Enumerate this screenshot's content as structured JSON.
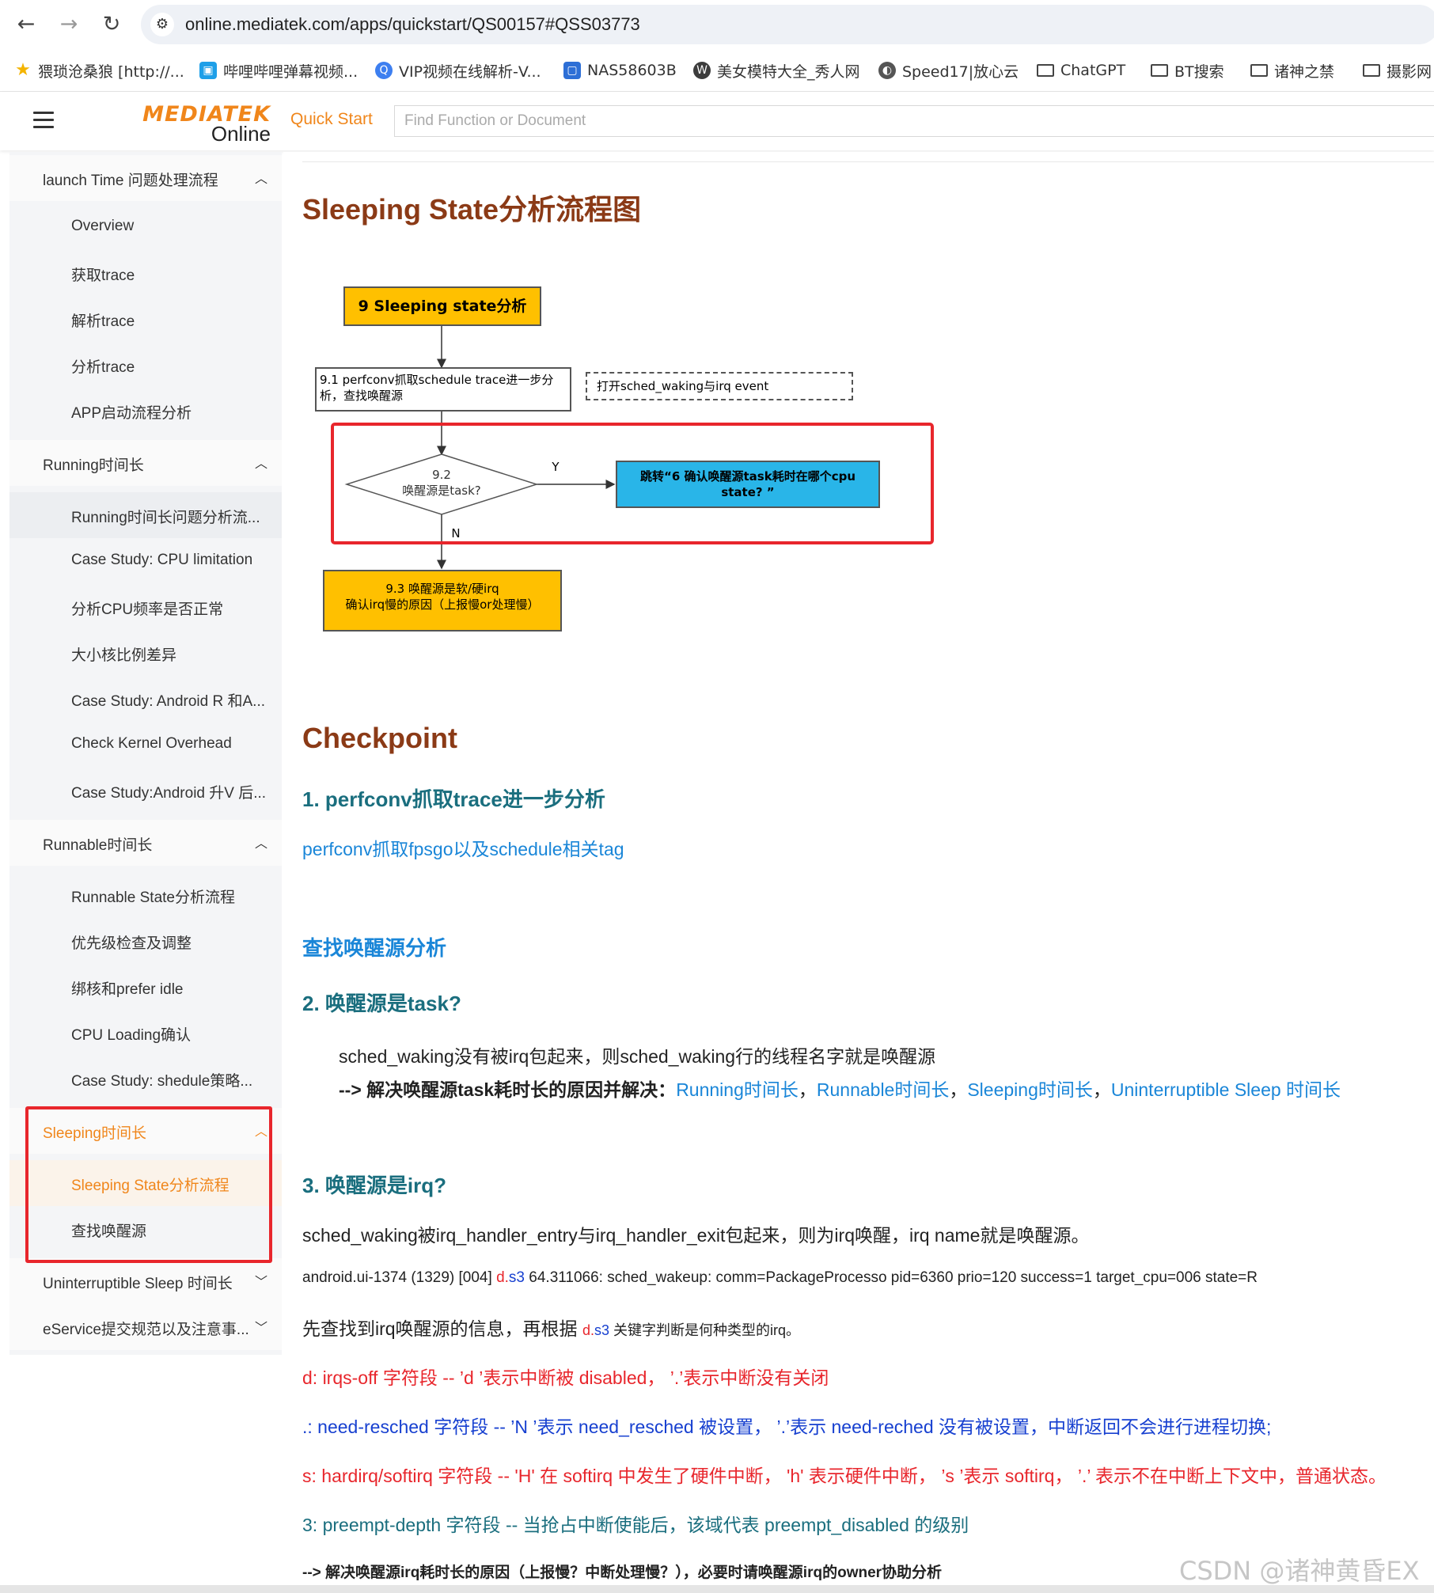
{
  "browser": {
    "back_icon": "arrow-left-icon",
    "forward_icon": "arrow-right-icon",
    "reload_icon": "reload-icon",
    "url": "online.mediatek.com/apps/quickstart/QS00157#QSS03773",
    "bookmarks": [
      {
        "label": "猥琐沧桑狼 [http://...",
        "icon": "star-icon",
        "color": "#f4b400"
      },
      {
        "label": "哔哩哔哩弹幕视频...",
        "icon": "bilibili-icon",
        "color": "#1e9fe8"
      },
      {
        "label": "VIP视频在线解析-V...",
        "icon": "q-icon",
        "color": "#3d7ff0"
      },
      {
        "label": "NAS58603B",
        "icon": "nas-icon",
        "color": "#2d6fd6"
      },
      {
        "label": "美女模特大全_秀人网",
        "icon": "wordpress-icon",
        "color": "#3c3c3c"
      },
      {
        "label": "Speed17|放心云",
        "icon": "globe-icon",
        "color": "#555"
      },
      {
        "label": "ChatGPT",
        "icon": "folder-icon",
        "color": "#444"
      },
      {
        "label": "BT搜索",
        "icon": "folder-icon",
        "color": "#444"
      },
      {
        "label": "诸神之禁",
        "icon": "folder-icon",
        "color": "#444"
      },
      {
        "label": "摄影网",
        "icon": "folder-icon",
        "color": "#444"
      }
    ]
  },
  "header": {
    "logo_top": "MEDIATEK",
    "logo_bottom": "Online",
    "quick_start": "Quick Start",
    "search_placeholder": "Find Function or Document",
    "brand_color": "#f0861b"
  },
  "sidebar": {
    "groups": [
      {
        "label": "launch Time 问题处理流程",
        "expanded": true,
        "items": [
          "Overview",
          "获取trace",
          "解析trace",
          "分析trace",
          "APP启动流程分析"
        ]
      },
      {
        "label": "Running时间长",
        "expanded": true,
        "items": [
          "Running时间长问题分析流...",
          "Case Study: CPU limitation",
          "分析CPU频率是否正常",
          "大小核比例差异",
          "Case Study: Android R 和A...",
          "Check Kernel Overhead",
          "Case Study:Android 升V 后..."
        ]
      },
      {
        "label": "Runnable时间长",
        "expanded": true,
        "items": [
          "Runnable State分析流程",
          "优先级检查及调整",
          "绑核和prefer idle",
          "CPU Loading确认",
          "Case Study: shedule策略..."
        ]
      },
      {
        "label": "Sleeping时间长",
        "expanded": true,
        "active": true,
        "items": [
          "Sleeping State分析流程",
          "查找唤醒源"
        ]
      },
      {
        "label": "Uninterruptible Sleep 时间长",
        "expanded": false,
        "items": []
      },
      {
        "label": "eService提交规范以及注意事...",
        "expanded": false,
        "items": []
      }
    ],
    "active_item": "Sleeping State分析流程"
  },
  "content": {
    "title": "Sleeping State分析流程图",
    "flowchart": {
      "start": "9 Sleeping  state分析",
      "step1": "9.1 perfconv抓取schedule trace进一步分析，查找唤醒源",
      "side_note": "打开sched_waking与irq event",
      "decision": "9.2\n唤醒源是task?",
      "yes_label": "Y",
      "no_label": "N",
      "yes_target": "跳转“6 确认唤醒源task耗时在哪个cpu state? ”",
      "no_target_line1": "9.3 唤醒源是软/硬irq",
      "no_target_line2": "确认irq慢的原因（上报慢or处理慢）"
    },
    "checkpoint_title": "Checkpoint",
    "sec1_title": "1. perfconv抓取trace进一步分析",
    "sec1_link": "perfconv抓取fpsgo以及schedule相关tag",
    "sec_find_title": "查找唤醒源分析",
    "sec2_title": "2. 唤醒源是task?",
    "sec2_line1": "sched_waking没有被irq包起来，则sched_waking行的线程名字就是唤醒源",
    "sec2_line2_prefix": "--> 解决唤醒源task耗时长的原因并解决：",
    "sec2_links": [
      "Running时间长",
      "Runnable时间长",
      "Sleeping时间长",
      "Uninterruptible Sleep 时间长"
    ],
    "sec2_sep": "，",
    "sec3_title": "3. 唤醒源是irq?",
    "sec3_line1": "sched_waking被irq_handler_entry与irq_handler_exit包起来，则为irq唤醒，irq name就是唤醒源。",
    "trace_prefix": "android.ui-1374 (1329) [004] ",
    "trace_d": "d.",
    "trace_s3": "s3",
    "trace_suffix": " 64.311066: sched_wakeup: comm=PackageProcesso pid=6360 prio=120 success=1 target_cpu=006 state=R",
    "find_line_prefix": "先查找到irq唤醒源的信息，再根据 ",
    "find_line_d": "d.",
    "find_line_s3": "s3",
    "find_line_suffix": " 关键字判断是何种类型的irq。",
    "legend_d": "d:  irqs-off 字符段 -- ’d ’表示中断被 disabled， ’.’表示中断没有关闭",
    "legend_dot": ".:  need-resched 字符段 -- ’N ’表示 need_resched 被设置， ’.’表示 need-reched 没有被设置，中断返回不会进行进程切换;",
    "legend_s": "s:  hardirq/softirq 字符段 -- 'H' 在 softirq 中发生了硬件中断， 'h' 表示硬件中断， ’s ’表示 softirq， ’.’ 表示不在中断上下文中，普通状态。",
    "legend_3": "3:  preempt-depth 字符段 -- 当抢占中断使能后，该域代表 preempt_disabled 的级别",
    "last_line": "--> 解决唤醒源irq耗时长的原因（上报慢？中断处理慢？），必要时请唤醒源irq的owner协助分析"
  },
  "watermark": "CSDN @诸神黄昏EX"
}
